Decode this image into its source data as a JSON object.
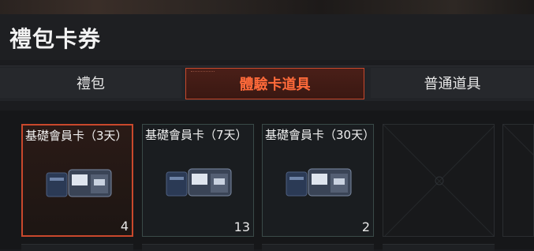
{
  "header": {
    "title": "禮包卡券"
  },
  "tabs": [
    {
      "label": "禮包",
      "active": false
    },
    {
      "label": "體驗卡道具",
      "active": true
    },
    {
      "label": "普通道具",
      "active": false
    }
  ],
  "items": [
    {
      "name": "基礎會員卡（3天）",
      "count": "4",
      "selected": true,
      "icon": "membership-card-pack-icon"
    },
    {
      "name": "基礎會員卡（7天）",
      "count": "13",
      "selected": false,
      "icon": "membership-card-pack-icon"
    },
    {
      "name": "基礎會員卡（30天）",
      "count": "2",
      "selected": false,
      "icon": "membership-card-pack-icon"
    }
  ],
  "colors": {
    "accent": "#c9482c",
    "active_tab_text": "#ff6a3a",
    "slot_border": "#3a4a48"
  }
}
